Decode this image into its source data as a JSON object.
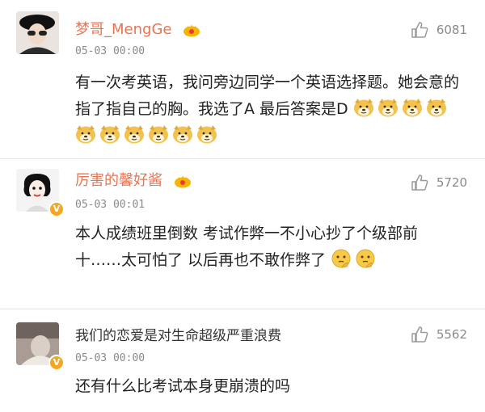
{
  "comments": [
    {
      "username": "梦哥_MengGe",
      "time": "05-03 00:00",
      "likes": "6081",
      "text": "有一次考英语，我问旁边同学一个英语选择题。她会意的指了指自己的胸。我选了A  最后答案是D",
      "vip_crown": true,
      "emoji": "doge-emoji",
      "emoji_count": 10
    },
    {
      "username": "厉害的馨好酱",
      "time": "05-03 00:01",
      "likes": "5720",
      "text": "本人成绩班里倒数 考试作弊一不小心抄了个级部前十……太可怕了 以后再也不敢作弊了",
      "vip_crown": true,
      "verified_badge": "V",
      "emoji": "thinking-emoji",
      "emoji_count": 2
    },
    {
      "username": "我们的恋爱是对生命超级严重浪费",
      "time": "05-03 00:00",
      "likes": "5562",
      "text": "还有什么比考试本身更崩溃的吗",
      "verified_badge": "V"
    }
  ],
  "colors": {
    "username": "#eb7350",
    "meta": "#8a8a8a",
    "badge": "#f5a623"
  }
}
